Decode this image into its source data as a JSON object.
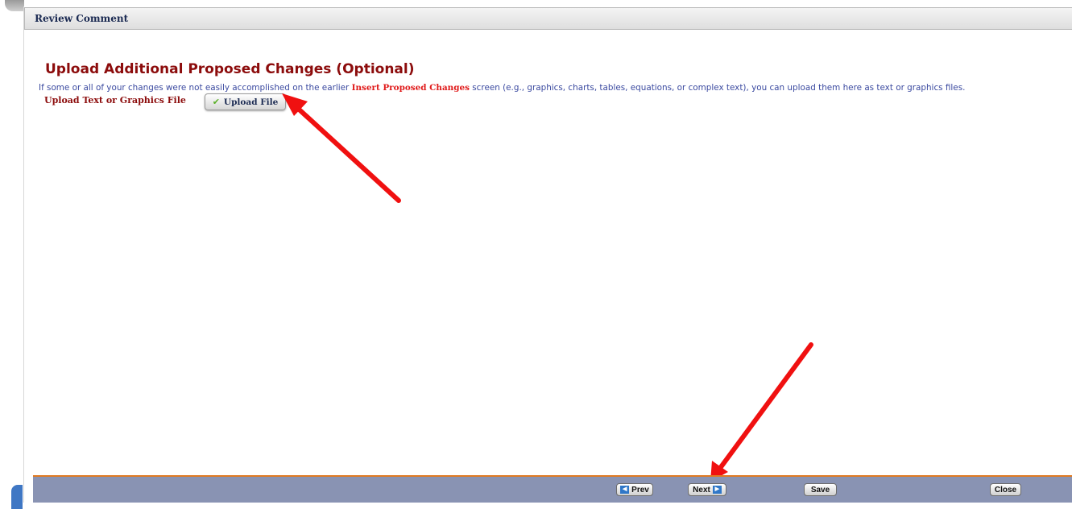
{
  "window": {
    "title": "Review Comment"
  },
  "main": {
    "heading": "Upload Additional Proposed Changes (Optional)",
    "description_before": "If some or all of your changes were not easily accomplished on the earlier ",
    "description_emphasis": "Insert Proposed Changes",
    "description_after": " screen (e.g., graphics, charts, tables, equations, or complex text), you can upload them here as text or graphics files.",
    "upload_label": "Upload Text or Graphics File",
    "upload_button": "Upload File",
    "upload_icon": "checkmark-icon"
  },
  "footer": {
    "prev_label": "Prev",
    "next_label": "Next",
    "save_label": "Save",
    "close_label": "Close",
    "prev_icon": "arrow-left-icon",
    "next_icon": "arrow-right-icon"
  },
  "colors": {
    "heading": "#8c0c0c",
    "emphasis": "#e01a1a",
    "footer_bar": "#8993b3",
    "footer_accent": "#e07a22",
    "annotation_arrow": "#f01010"
  }
}
